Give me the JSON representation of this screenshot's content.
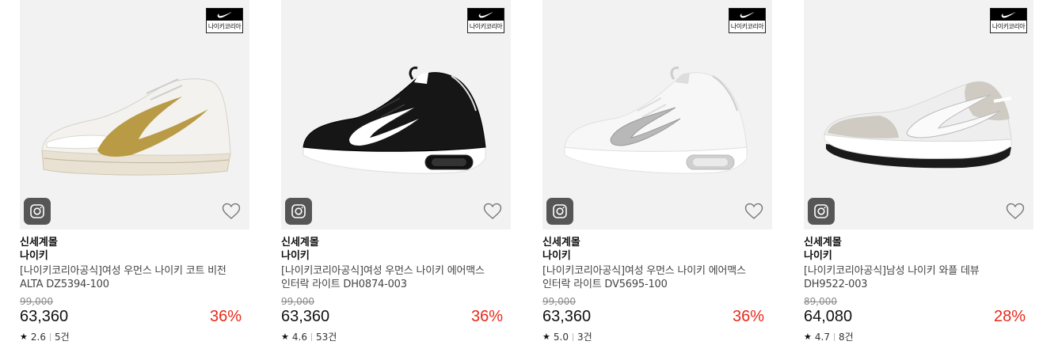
{
  "products": [
    {
      "brand_tag": "나이키코리아",
      "store": "신세계몰",
      "brand": "나이키",
      "name": "[나이키코리아공식]여성 우먼스 나이키 코트 비전 ALTA DZ5394-100",
      "original_price": "99,000",
      "price": "63,360",
      "discount": "36%",
      "rating_star": "★",
      "rating": "2.6",
      "reviews": "5건",
      "shoe_colors": {
        "upper": "#f3f2ee",
        "swoosh": "#b99a45",
        "sole": "#e9e2d2",
        "mid": "#d8cfbd",
        "accent": "#ffffff"
      }
    },
    {
      "brand_tag": "나이키코리아",
      "store": "신세계몰",
      "brand": "나이키",
      "name": "[나이키코리아공식]여성 우먼스 나이키 에어맥스 인터락 라이트 DH0874-003",
      "original_price": "99,000",
      "price": "63,360",
      "discount": "36%",
      "rating_star": "★",
      "rating": "4.6",
      "reviews": "53건",
      "shoe_colors": {
        "upper": "#161616",
        "swoosh": "#ffffff",
        "sole": "#ffffff",
        "mid": "#111111",
        "accent": "#2a2a2a"
      }
    },
    {
      "brand_tag": "나이키코리아",
      "store": "신세계몰",
      "brand": "나이키",
      "name": "[나이키코리아공식]여성 우먼스 나이키 에어맥스 인터락 라이트 DV5695-100",
      "original_price": "99,000",
      "price": "63,360",
      "discount": "36%",
      "rating_star": "★",
      "rating": "5.0",
      "reviews": "3건",
      "shoe_colors": {
        "upper": "#f7f7f7",
        "swoosh": "#b8b8b8",
        "sole": "#ffffff",
        "mid": "#e8e8e8",
        "accent": "#dcdcdc"
      }
    },
    {
      "brand_tag": "나이키코리아",
      "store": "신세계몰",
      "brand": "나이키",
      "name": "[나이키코리아공식]남성 나이키 와플 데뷰 DH9522-003",
      "original_price": "89,000",
      "price": "64,080",
      "discount": "28%",
      "rating_star": "★",
      "rating": "4.7",
      "reviews": "8건",
      "shoe_colors": {
        "upper": "#eeeeee",
        "swoosh": "#ffffff",
        "sole": "#ffffff",
        "mid": "#1a1a1a",
        "accent": "#cfcac2"
      }
    }
  ]
}
